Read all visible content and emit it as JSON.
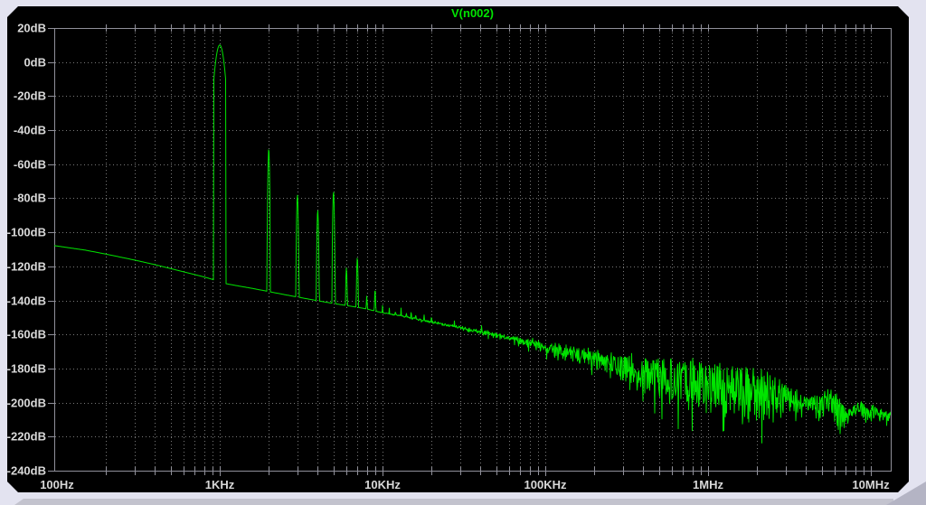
{
  "window": {
    "background": "#e3e3f0",
    "panel_background": "#000000",
    "shadow_color": "#c3c3ce",
    "corner_shadow_color": "#b4b4c4"
  },
  "chart_data": {
    "type": "line",
    "title": "V(n002)",
    "title_color": "#00e400",
    "trace_color": "#00e400",
    "grid_color": "#787878",
    "axis_color": "#90909a",
    "label_color": "#d8d8d8",
    "x_axis": {
      "scale": "log",
      "unit": "Hz",
      "min": 100,
      "max": 13250000,
      "tick_labels": [
        "100Hz",
        "1KHz",
        "10KHz",
        "100KHz",
        "1MHz",
        "10MHz"
      ],
      "tick_values": [
        100,
        1000,
        10000,
        100000,
        1000000,
        10000000
      ],
      "grid": true
    },
    "y_axis": {
      "unit": "dB",
      "min": -240,
      "max": 20,
      "step": 20,
      "tick_labels": [
        "20dB",
        "0dB",
        "-20dB",
        "-40dB",
        "-60dB",
        "-80dB",
        "-100dB",
        "-120dB",
        "-140dB",
        "-160dB",
        "-180dB",
        "-200dB",
        "-220dB",
        "-240dB"
      ],
      "grid": true
    },
    "fundamental": {
      "hz": 1000,
      "db": 10
    },
    "harmonics": [
      [
        1000,
        10
      ],
      [
        2000,
        -51
      ],
      [
        3000,
        -78
      ],
      [
        4000,
        -87
      ],
      [
        5000,
        -76
      ],
      [
        6000,
        -121
      ],
      [
        7000,
        -115
      ],
      [
        8000,
        -137.5
      ],
      [
        9000,
        -133.5
      ],
      [
        10000,
        -143
      ],
      [
        11000,
        -144.5
      ],
      [
        12000,
        -146
      ],
      [
        13000,
        -144.5
      ],
      [
        14000,
        -147
      ],
      [
        15000,
        -146.5
      ],
      [
        16000,
        -148
      ],
      [
        18000,
        -148.5
      ],
      [
        20000,
        -149.5
      ]
    ],
    "noise_floor_db": [
      [
        96,
        -107.8
      ],
      [
        150,
        -110.5
      ],
      [
        200,
        -112.8
      ],
      [
        300,
        -116.3
      ],
      [
        400,
        -119
      ],
      [
        500,
        -121.3
      ],
      [
        600,
        -123.2
      ],
      [
        700,
        -124.8
      ],
      [
        800,
        -126.2
      ],
      [
        900,
        -127.6
      ],
      [
        1000,
        -129.5
      ],
      [
        1300,
        -131.5
      ],
      [
        1600,
        -133
      ],
      [
        2000,
        -134.8
      ],
      [
        2500,
        -136.6
      ],
      [
        3000,
        -138
      ],
      [
        4000,
        -140.2
      ],
      [
        5000,
        -141.8
      ],
      [
        6000,
        -143
      ],
      [
        7000,
        -144
      ],
      [
        8000,
        -145
      ],
      [
        9000,
        -146.2
      ],
      [
        10000,
        -147.2
      ],
      [
        13000,
        -149
      ],
      [
        16000,
        -150.8
      ],
      [
        20000,
        -152.5
      ],
      [
        30000,
        -155.8
      ],
      [
        50000,
        -160
      ],
      [
        70000,
        -162.8
      ],
      [
        100000,
        -165.8
      ],
      [
        150000,
        -168.8
      ],
      [
        200000,
        -170.8
      ],
      [
        300000,
        -173.3
      ],
      [
        500000,
        -175.3
      ],
      [
        700000,
        -176.4
      ],
      [
        1000000,
        -177.8
      ],
      [
        1500000,
        -179.8
      ],
      [
        2000000,
        -181.8
      ],
      [
        2500000,
        -185.5
      ],
      [
        3000000,
        -190.5
      ],
      [
        3500000,
        -194.5
      ],
      [
        4000000,
        -197
      ],
      [
        4500000,
        -198
      ],
      [
        5000000,
        -197.5
      ],
      [
        5600000,
        -194.5
      ],
      [
        6000000,
        -196.5
      ],
      [
        6500000,
        -201.5
      ],
      [
        7000000,
        -203.5
      ],
      [
        7500000,
        -204
      ],
      [
        8000000,
        -202
      ],
      [
        8500000,
        -200.5
      ],
      [
        9000000,
        -202.5
      ],
      [
        9500000,
        -204
      ],
      [
        10000000,
        -203
      ],
      [
        11000000,
        -204.5
      ],
      [
        12000000,
        -205.5
      ],
      [
        13250000,
        -206.5
      ]
    ],
    "noise_band_up_db": [
      [
        8000,
        0
      ],
      [
        15000,
        0.6
      ],
      [
        30000,
        1
      ],
      [
        60000,
        1.6
      ],
      [
        100000,
        2.2
      ],
      [
        200000,
        2.6
      ],
      [
        500000,
        3
      ],
      [
        1000000,
        3.2
      ],
      [
        2000000,
        3.2
      ],
      [
        3000000,
        2.6
      ],
      [
        5000000,
        3
      ],
      [
        5600000,
        4
      ],
      [
        8000000,
        3
      ],
      [
        13250000,
        3
      ]
    ],
    "noise_band_down_db": [
      [
        8000,
        0
      ],
      [
        15000,
        0.8
      ],
      [
        30000,
        1.6
      ],
      [
        60000,
        3
      ],
      [
        100000,
        6
      ],
      [
        150000,
        8
      ],
      [
        200000,
        10
      ],
      [
        300000,
        14
      ],
      [
        400000,
        20
      ],
      [
        500000,
        24
      ],
      [
        700000,
        28
      ],
      [
        1000000,
        30
      ],
      [
        1500000,
        30
      ],
      [
        2000000,
        31
      ],
      [
        2400000,
        30
      ],
      [
        2800000,
        22
      ],
      [
        3200000,
        13
      ],
      [
        4000000,
        10
      ],
      [
        5000000,
        9
      ],
      [
        5600000,
        12
      ],
      [
        6300000,
        22
      ],
      [
        7000000,
        11
      ],
      [
        8000000,
        7.5
      ],
      [
        9000000,
        8
      ],
      [
        10000000,
        9
      ],
      [
        11000000,
        7
      ],
      [
        13250000,
        6.5
      ]
    ]
  }
}
